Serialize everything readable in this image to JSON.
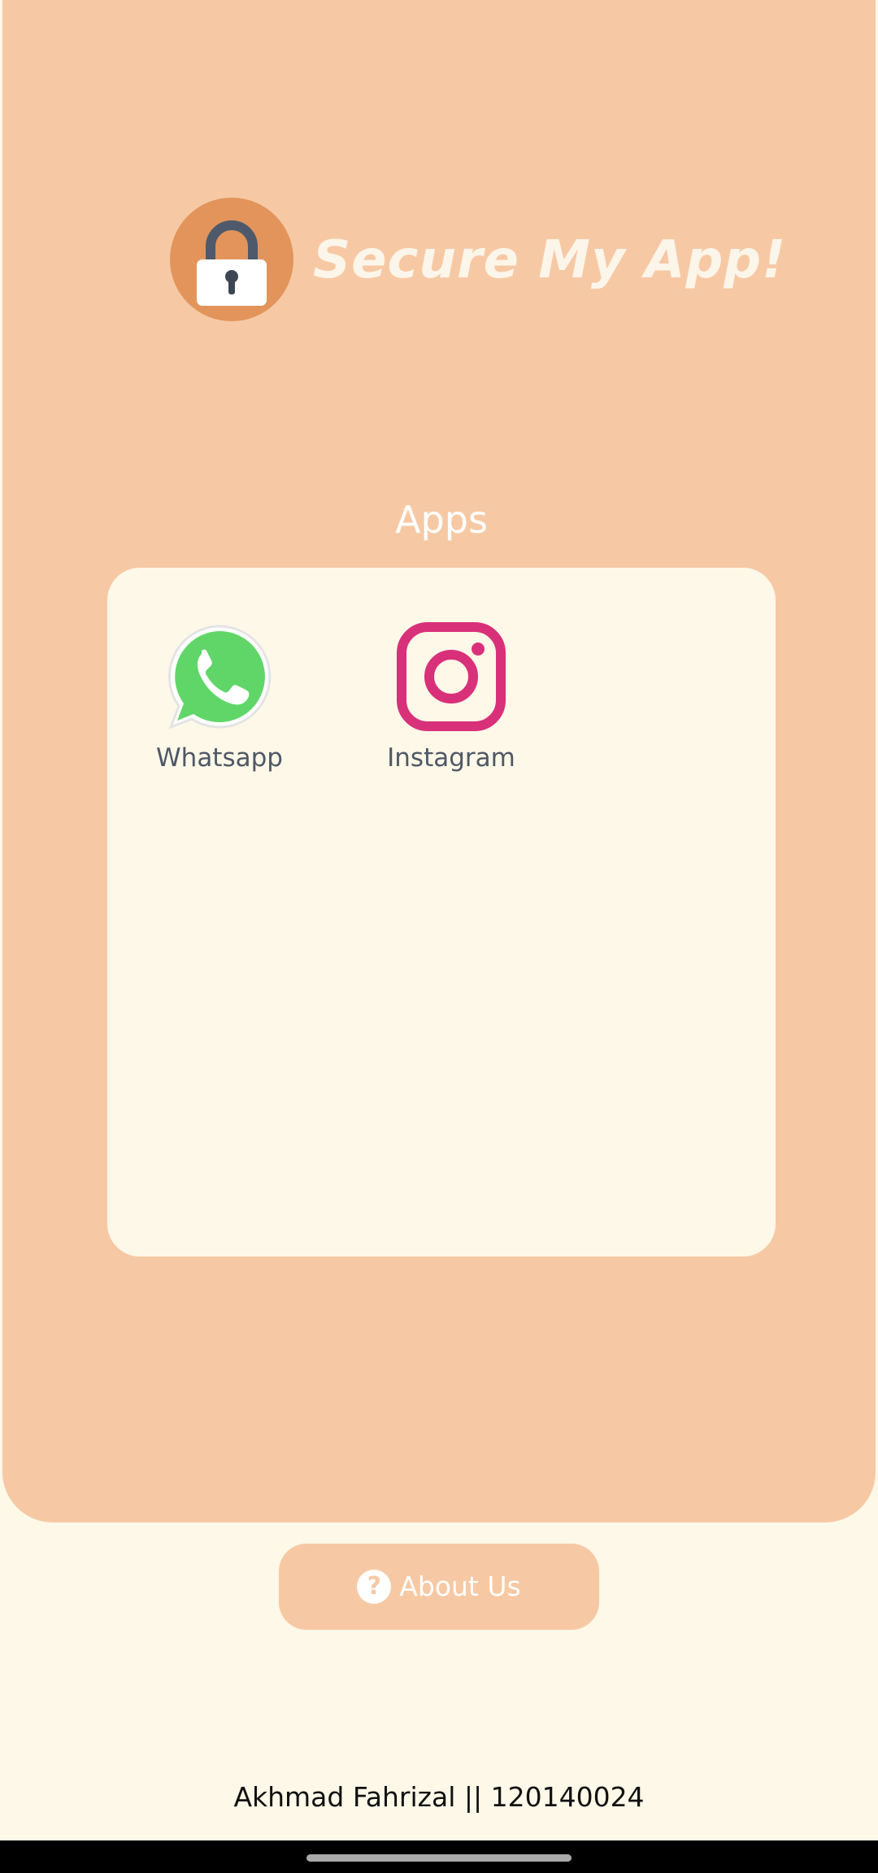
{
  "header": {
    "title": "Secure My App!",
    "logo_icon": "padlock-icon"
  },
  "apps_section": {
    "heading": "Apps",
    "apps": [
      {
        "label": "Whatsapp",
        "icon": "whatsapp-icon"
      },
      {
        "label": "Instagram",
        "icon": "instagram-icon"
      }
    ]
  },
  "about_button": {
    "label": "About Us",
    "icon": "question-circle-icon"
  },
  "footer": {
    "text": "Akhmad Fahrizal || 120140024"
  },
  "colors": {
    "panel": "#F6C9A4",
    "background": "#FDF8E8",
    "logo_circle": "#E2945B",
    "whatsapp_green": "#60D669",
    "instagram_pink": "#D9307A"
  }
}
